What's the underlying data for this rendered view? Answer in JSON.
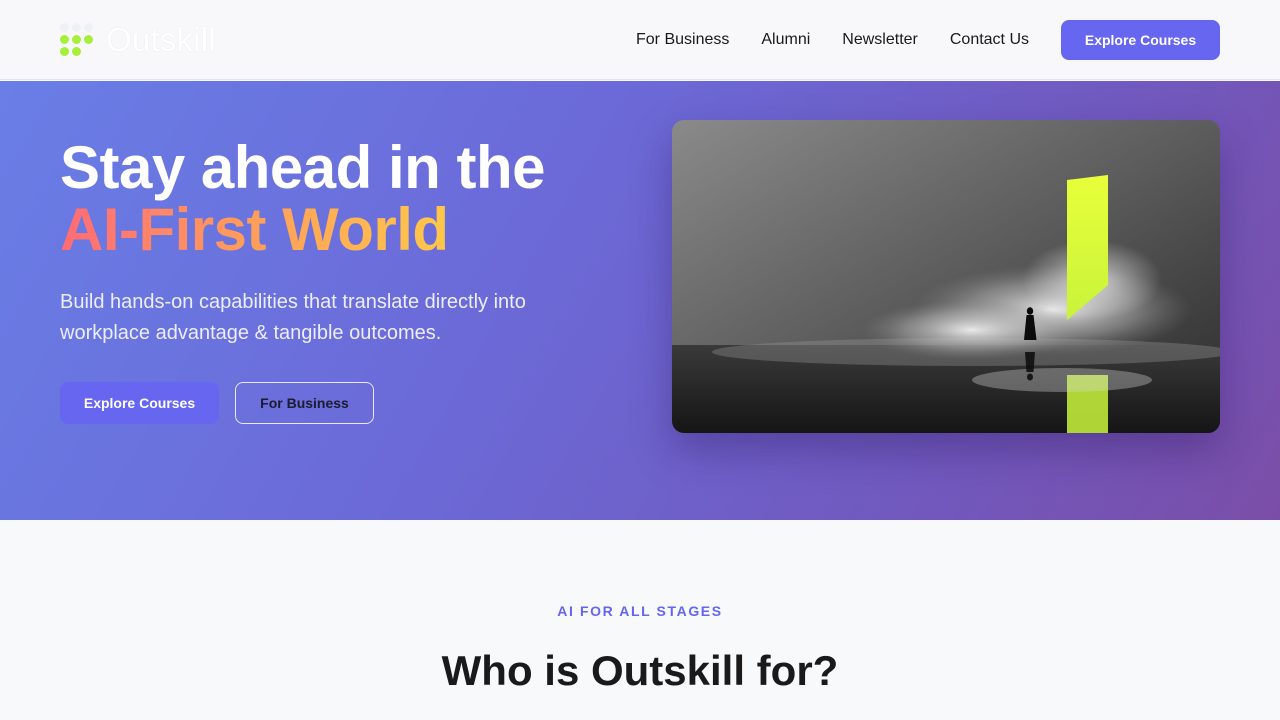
{
  "header": {
    "logo_text": "Outskill",
    "nav": [
      {
        "label": "For Business"
      },
      {
        "label": "Alumni"
      },
      {
        "label": "Newsletter"
      },
      {
        "label": "Contact Us"
      }
    ],
    "cta_label": "Explore Courses"
  },
  "hero": {
    "title_line1": "Stay ahead in the",
    "title_line2": "AI-First World",
    "subtitle": "Build hands-on capabilities that translate directly into workplace advantage & tangible outcomes.",
    "primary_label": "Explore Courses",
    "secondary_label": "For Business",
    "image_icon": "person-before-glowing-portal-image"
  },
  "section": {
    "eyebrow": "AI FOR ALL STAGES",
    "title": "Who is Outskill for?"
  },
  "colors": {
    "brand_accent": "#6666f1",
    "logo_green": "#a6ef3a",
    "gradient_start": "#ff6b76",
    "gradient_end": "#ffc84a"
  }
}
